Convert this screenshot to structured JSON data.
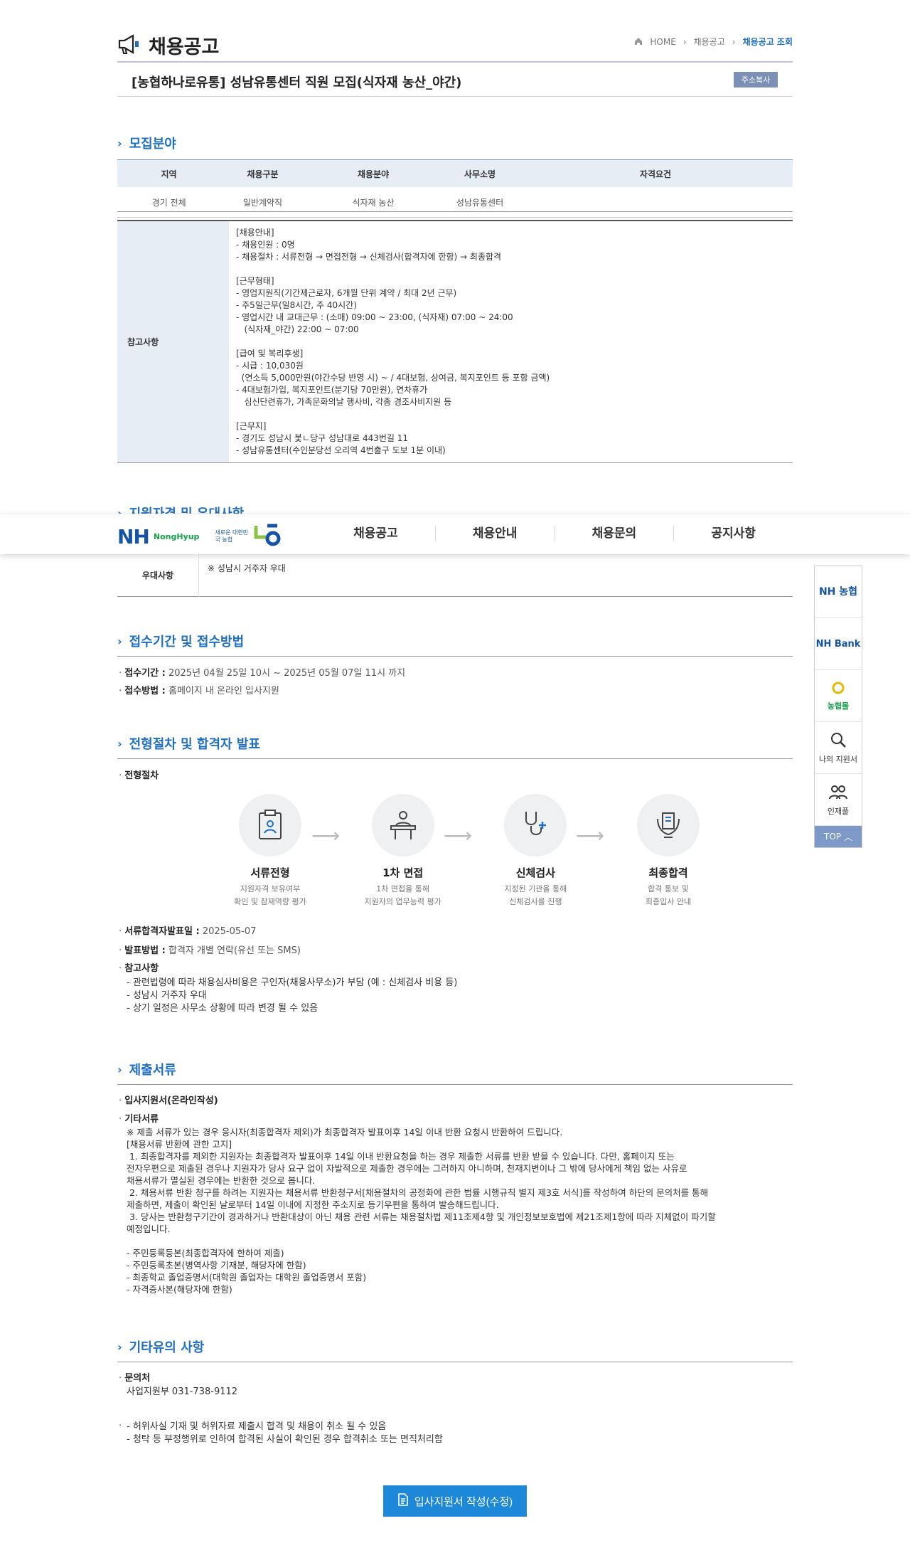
{
  "header": {
    "page_title": "채용공고",
    "breadcrumb": [
      "HOME",
      "채용공고",
      "채용공고 조회"
    ]
  },
  "job": {
    "title": "[농협하나로유통] 성남유통센터 직원 모집(식자재 농산_야간)",
    "copy_label": "주소복사"
  },
  "recruit": {
    "section_title": "모집분야",
    "columns": [
      "지역",
      "채용구분",
      "채용분야",
      "사무소명",
      "자격요건"
    ],
    "row": [
      "경기 전체",
      "일반계약직",
      "식자재 농산",
      "성남유통센터",
      ""
    ],
    "note_label": "참고사항",
    "note_body": "[채용안내]\n- 채용인원 : 0명\n- 채용절차 : 서류전형 → 면접전형 → 신체검사(합격자에 한함) → 최종합격\n\n[근무형태]\n- 영업지원직(기간제근로자, 6개월 단위 계약 / 최대 2년 근무)\n- 주5일근무(일8시간, 주 40시간)\n- 영업시간 내 교대근무 : (소매) 09:00 ~ 23:00, (식자재) 07:00 ~ 24:00\n   (식자재_야간) 22:00 ~ 07:00\n\n[급여 및 복리후생]\n- 시급 : 10,030원\n  (연소득 5,000만원(야간수당 반영 시) ~ / 4대보험, 상여금, 복지포인트 등 포함 금액)\n- 4대보험가입, 복지포인트(분기당 70만원), 연차휴가\n   심신단련휴가, 가족문화의날 행사비, 각종 경조사비지원 등\n\n[근무지]\n- 경기도 성남시 붗ㄴ당구 성남대로 443번길 11\n- 성남유통센터(수인분당선 오리역 4번출구 도보 1분 이내)"
  },
  "qualification": {
    "section_title": "지원자격 및 우대사항",
    "pref_label": "우대사항",
    "pref_value": "※ 성남시 거주자 우대"
  },
  "gnb": {
    "brand": "NH",
    "brand_sub": "NongHyup",
    "slogan": "새로운 대한민국 농협",
    "menu": [
      "채용공고",
      "채용안내",
      "채용문의",
      "공지사항"
    ]
  },
  "period": {
    "section_title": "접수기간 및 접수방법",
    "period_label": "접수기간 :",
    "period_value": "2025년 04월 25일 10시 ~ 2025년 05월 07일 11시 까지",
    "method_label": "접수방법 :",
    "method_value": "홈페이지 내 온라인 입사지원"
  },
  "process": {
    "section_title": "전형절차 및 합격자 발표",
    "sub_label": "전형절차",
    "steps": [
      {
        "name": "서류전형",
        "desc": "지원자격 보유여부\n확인 및 잠재역량 평가"
      },
      {
        "name": "1차 면접",
        "desc": "1차 면접을 통해\n지원자의 업무능력 평가"
      },
      {
        "name": "신체검사",
        "desc": "지정된 기관을 통해\n신체검사를 진행"
      },
      {
        "name": "최종합격",
        "desc": "합격 통보 및\n최종입사 안내"
      }
    ],
    "doc_date_label": "서류합격자발표일 :",
    "doc_date_value": "2025-05-07",
    "announce_label": "발표방법 :",
    "announce_value": "합격자 개별 연락(유선 또는 SMS)",
    "ref_label": "참고사항",
    "ref_body": "- 관련법령에 따라 채용심사비용은 구인자(채용사무소)가 부담 (예 : 신체검사 비용 등)\n- 성남시 거주자 우대\n- 상기 일정은 사무소 상황에 따라 변경 될 수 있음"
  },
  "documents": {
    "section_title": "제출서류",
    "item1": "입사지원서(온라인작성)",
    "item2": "기타서류",
    "body": "※ 제출 서류가 있는 경우 응시자(최종합격자 제외)가 최종합격자 발표이후 14일 이내 반환 요청시 반환하여 드립니다.\n[채용서류 반환에 관한 고지]\n 1. 최종합격자를 제외한 지원자는 최종합격자 발표이후 14일 이내 반환요청을 하는 경우 제출한 서류를 반환 받을 수 있습니다. 다만, 홈페이지 또는\n전자우편으로 제출된 경우나 지원자가 당사 요구 없이 자발적으로 제출한 경우에는 그러하지 아니하며, 천재지변이나 그 밖에 당사에게 책임 없는 사유로\n채용서류가 멸실된 경우에는 반환한 것으로 봅니다.\n 2. 채용서류 반환 청구를 하려는 지원자는 채용서류 반환청구서[채용절차의 공정화에 관한 법률 시행규칙 별지 제3호 서식]를 작성하여 하단의 문의처를 통해\n제출하면, 제출이 확인된 날로부터 14일 이내에 지정한 주소지로 등기우편을 통하여 발송해드립니다.\n 3. 당사는 반환청구기간이 경과하거나 반환대상이 아닌 채용 관련 서류는 채용절차법 제11조제4항 및 개인정보보호법에 제21조제1항에 따라 지체없이 파기할\n예정입니다.\n\n- 주민등록등본(최종합격자에 한하여 제출)\n- 주민등록초본(병역사항 기재분, 해당자에 한함)\n- 최종학교 졸업증명서(대학원 졸업자는 대학원 졸업증명서 포함)\n- 자격증사본(해당자에 한함)"
  },
  "etc": {
    "section_title": "기타유의 사항",
    "contact_label": "문의처",
    "contact_value": "사업지원부 031-738-9112",
    "body": "- 허위사실 기재 및 허위자료 제출시 합격 및 채용이 취소 될 수 있음\n- 청탁 등 부정행위로 인하여 합격된 사실이 확인된 경우 합격취소 또는 면직처리함"
  },
  "quick_menu": {
    "items": [
      "NH 농협",
      "NH Bank",
      "농협몰",
      "나의 지원서",
      "인재풀"
    ],
    "top": "TOP"
  },
  "apply_button": "입사지원서 작성(수정)",
  "colors": {
    "accent": "#1f6fc3",
    "button": "#1e88d8",
    "table_head": "#e6edf5"
  }
}
